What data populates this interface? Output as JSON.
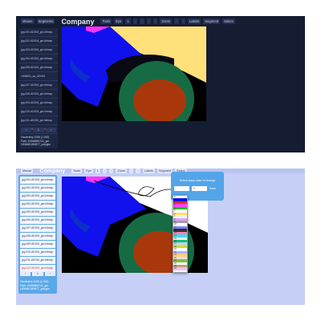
{
  "panels": {
    "dark": {
      "toolbar": [
        "Mouse",
        "Segments",
        "Company",
        "Tools",
        "Eye",
        "1",
        "",
        "",
        "",
        "",
        "Zoom",
        "",
        "",
        "Labels",
        "Segment",
        "Select"
      ],
      "files": [
        "jpg-001-ADGM_gm.bitmap",
        "jpg-002-ADGM_gm.bitmap",
        "jpg-003-ADGM_gm.bitmap",
        "jpg-004-ADGM_gm.bitmap",
        "jpg-005-ADGM_gm.bitmap",
        "1006801_ac_ADGM",
        "jpg-007-ADGM_gm.bitmap",
        "jpg-008-ADGM_gm.bitmap",
        "jpg-009-ADGM_gm.bitmap",
        "jpg-010-ADGM_gm.bitmap",
        "jpg-011-ADGM_gm.bitmap",
        "jpg-012-ADGM_gm.bitmap"
      ],
      "pager": [
        "‹",
        "1",
        "›"
      ],
      "info": [
        "Ownership 1006 (1,000)",
        "Path: 10066850741_gm",
        "1006681050877_polygon"
      ]
    },
    "light": {
      "toolbar": [
        "Mouse",
        "Company",
        "Tools",
        "Eye",
        "1",
        "",
        "",
        "Zoom",
        "",
        "",
        "Labels",
        "Segment",
        "Select"
      ],
      "files": [
        "jpg-001-ADGM_gm.bitmap",
        "jpg-002-ADGM_gm.bitmap",
        "jpg-003-ADGM_gm.bitmap",
        "jpg-004-ADGM_gm.bitmap",
        "jpg-005-ADGM_gm.bitmap",
        "jpg-006-ADGM_gm.bitmap",
        "jpg-007-ADGM_gm.bitmap",
        "jpg-008-ADGM_gm.bitmap",
        "jpg-009-ADGM_gm.bitmap",
        "jpg-010-ADGM_gm.bitmap",
        "jpg-011-ADGM_gm.bitmap",
        "jpg-012-ADGM_gm.bitmap"
      ],
      "pager": [
        "‹",
        "1",
        "›"
      ],
      "info": [
        "Ownership 1006 (1,000)",
        "Path: 10066850741_gm",
        "1006681050877_polygon"
      ],
      "popup": {
        "title": "Select class color to change",
        "select_value": "",
        "second_value": "1",
        "button": "Save"
      },
      "colors": [
        "#ffffff",
        "#1010e0",
        "#e03030",
        "#ff40ff",
        "#20c020",
        "#ffffff",
        "#ffe060",
        "#f0f0f0",
        "#e0a0ff",
        "#a0a0a0",
        "#ffffff",
        "#8080ff",
        "#303030",
        "#ff80c0",
        "#40e0e0",
        "#f0f0f0",
        "#00c080",
        "#d0d0d0",
        "#c0e040",
        "#ffffff",
        "#b0b0ff",
        "#ffd080",
        "#e0e0e0",
        "#80c040",
        "#ffffff",
        "#c0a080",
        "#f0c0f0"
      ]
    }
  }
}
